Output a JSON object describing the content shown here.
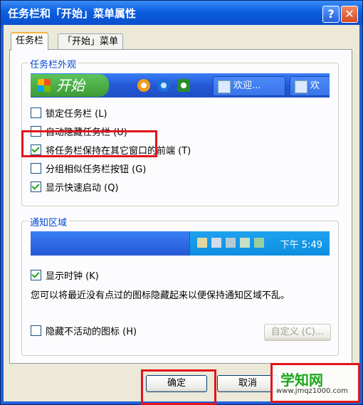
{
  "window": {
    "title": "任务栏和「开始」菜单属性",
    "help_label": "?",
    "close_label": "✕"
  },
  "tabs": [
    {
      "label": "任务栏"
    },
    {
      "label": "「开始」菜单"
    }
  ],
  "appearance": {
    "group_label": "任务栏外观",
    "preview": {
      "start_label": "开始",
      "task_buttons": [
        {
          "label": "欢迎..."
        },
        {
          "label": "欢"
        }
      ],
      "quicklaunch_icons": [
        "media-player-icon",
        "ie-icon",
        "outlook-icon"
      ]
    },
    "options": [
      {
        "label": "锁定任务栏 (L)",
        "checked": false
      },
      {
        "label": "自动隐藏任务栏 (U)",
        "checked": false
      },
      {
        "label": "将任务栏保持在其它窗口的前端 (T)",
        "checked": true
      },
      {
        "label": "分组相似任务栏按钮 (G)",
        "checked": false
      },
      {
        "label": "显示快速启动 (Q)",
        "checked": true
      }
    ]
  },
  "notification": {
    "group_label": "通知区域",
    "tray_time": "下午 5:49",
    "tray_icons": [
      "tray-icon-1",
      "tray-icon-2",
      "tray-icon-3",
      "tray-icon-4",
      "tray-icon-5"
    ],
    "show_clock": {
      "label": "显示时钟 (K)",
      "checked": true
    },
    "description": "您可以将最近没有点过的图标隐藏起来以便保持通知区域不乱。",
    "hide_inactive": {
      "label": "隐藏不活动的图标 (H)",
      "checked": false
    },
    "customize_label": "自定义 (C)..."
  },
  "buttons": {
    "ok_label": "确定",
    "cancel_label": "取消"
  },
  "watermark": {
    "title": "学知网",
    "url": "www.jmqz1000.com"
  }
}
